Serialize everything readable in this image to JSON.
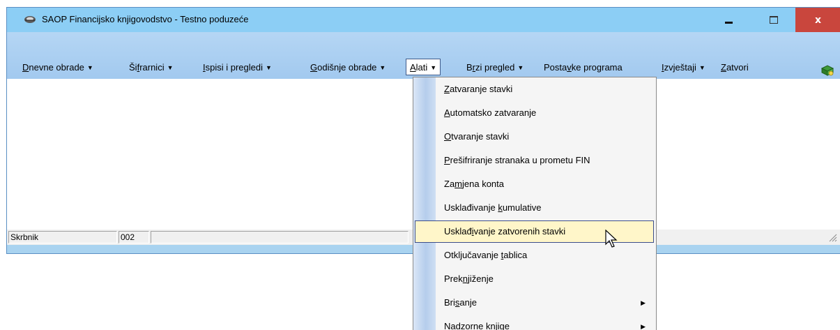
{
  "window": {
    "title": "SAOP Financijsko knjigovodstvo - Testno poduzeće",
    "close_glyph": "x",
    "icons": {
      "app": "app-logo-icon",
      "minimize": "minimize-icon",
      "maximize": "maximize-icon",
      "close": "close-icon"
    }
  },
  "menubar": {
    "items": [
      {
        "pre": "",
        "key": "D",
        "post": "nevne obrade",
        "arrow": "▼"
      },
      {
        "pre": "Ši",
        "key": "f",
        "post": "rarnici",
        "arrow": "▼"
      },
      {
        "pre": "",
        "key": "I",
        "post": "spisi i pregledi",
        "arrow": "▼"
      },
      {
        "pre": "",
        "key": "G",
        "post": "odišnje obrade",
        "arrow": "▼"
      },
      {
        "pre": "",
        "key": "A",
        "post": "lati",
        "arrow": "▼"
      },
      {
        "pre": "B",
        "key": "r",
        "post": "zi pregled",
        "arrow": "▼"
      },
      {
        "pre": "Posta",
        "key": "v",
        "post": "ke programa",
        "arrow": ""
      },
      {
        "pre": "",
        "key": "I",
        "post": "zvještaji",
        "arrow": "▼"
      },
      {
        "pre": "",
        "key": "Z",
        "post": "atvori",
        "arrow": ""
      }
    ],
    "toolbar_icons": [
      "help-book-icon",
      "exit-document-icon"
    ]
  },
  "statusbar": {
    "user": "Skrbnik",
    "code": "002"
  },
  "dropdown": {
    "items": [
      {
        "pre": "",
        "key": "Z",
        "post": "atvaranje stavki",
        "submenu": false
      },
      {
        "pre": "",
        "key": "A",
        "post": "utomatsko zatvaranje",
        "submenu": false
      },
      {
        "pre": "",
        "key": "O",
        "post": "tvaranje stavki",
        "submenu": false
      },
      {
        "pre": "",
        "key": "P",
        "post": "rešifriranje stranaka u prometu FIN",
        "submenu": false
      },
      {
        "pre": "Za",
        "key": "m",
        "post": "jena konta",
        "submenu": false
      },
      {
        "pre": "Usklađivanje ",
        "key": "k",
        "post": "umulative",
        "submenu": false
      },
      {
        "pre": "Usklađ",
        "key": "i",
        "post": "vanje zatvorenih stavki",
        "submenu": false
      },
      {
        "pre": "Otključavanje ",
        "key": "t",
        "post": "ablica",
        "submenu": false
      },
      {
        "pre": "Prek",
        "key": "n",
        "post": "jiženje",
        "submenu": false
      },
      {
        "pre": "Bri",
        "key": "s",
        "post": "anje",
        "submenu": true
      },
      {
        "pre": "",
        "key": "",
        "post": "Nadzorne knjige",
        "submenu": true
      }
    ],
    "highlighted_index": 6,
    "submenu_arrow": "▶"
  },
  "colors": {
    "title_bar": "#8ccef5",
    "menubar": "#a9d3f0",
    "close_button": "#c9463d",
    "highlight": "#fff6c9"
  }
}
